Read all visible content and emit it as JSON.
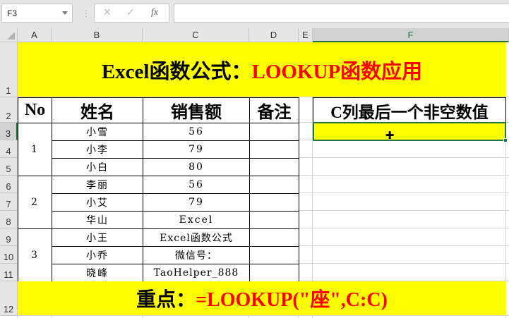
{
  "formula_bar": {
    "name_box": "F3",
    "cancel_icon": "✕",
    "enter_icon": "✓",
    "fx_label": "fx",
    "formula": ""
  },
  "columns": [
    "A",
    "B",
    "C",
    "D",
    "E",
    "F"
  ],
  "rows": [
    "1",
    "2",
    "3",
    "4",
    "5",
    "6",
    "7",
    "8",
    "9",
    "10",
    "11",
    "12"
  ],
  "title": {
    "black": "Excel函数公式：",
    "red": "LOOKUP函数应用"
  },
  "table": {
    "headers": [
      "No",
      "姓名",
      "销售额",
      "备注"
    ],
    "groups": [
      "1",
      "2",
      "3"
    ],
    "names": [
      "小雪",
      "小李",
      "小白",
      "李丽",
      "小艾",
      "华山",
      "小王",
      "小乔",
      "晓峰"
    ],
    "sales": [
      "56",
      "79",
      "80",
      "56",
      "79",
      "Excel",
      "Excel函数公式",
      "微信号：",
      "TaoHelper_888"
    ]
  },
  "result": {
    "header": "C列最后一个非空数值",
    "value": ""
  },
  "footer": {
    "black": "重点：",
    "red": "=LOOKUP(\"座\",C:C)"
  },
  "colors": {
    "highlight": "#ffff00",
    "accent_red": "#ff0000",
    "selection": "#217346"
  }
}
